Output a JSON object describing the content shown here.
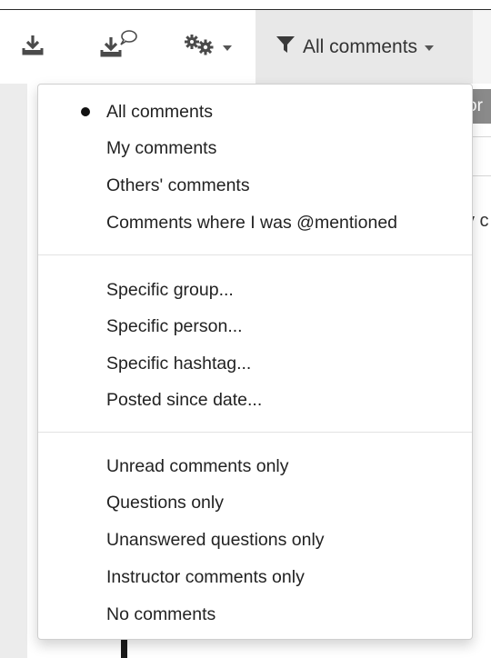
{
  "toolbar": {
    "download_icon": "download-icon",
    "download_comments_icon": "download-comment-icon",
    "settings_icon": "gears-icon",
    "filter_icon": "filter-icon",
    "filter_label": "All comments"
  },
  "background": {
    "header_fragment": "or",
    "text_fragment": "y c"
  },
  "menu": {
    "selected_index": 0,
    "groups": [
      [
        "All comments",
        "My comments",
        "Others' comments",
        "Comments where I was @mentioned"
      ],
      [
        "Specific group...",
        "Specific person...",
        "Specific hashtag...",
        "Posted since date..."
      ],
      [
        "Unread comments only",
        "Questions only",
        "Unanswered questions only",
        "Instructor comments only",
        "No comments"
      ]
    ]
  }
}
